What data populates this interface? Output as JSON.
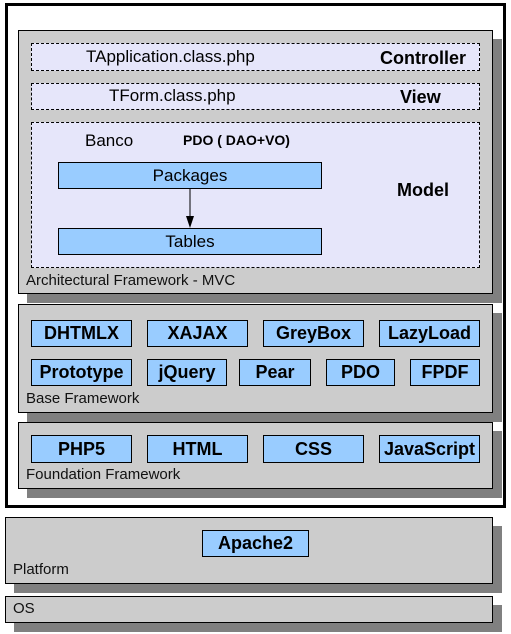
{
  "architectural": {
    "label": "Architectural Framework - MVC",
    "controller": {
      "file": "TApplication.class.php",
      "role": "Controller"
    },
    "view": {
      "file": "TForm.class.php",
      "role": "View"
    },
    "model": {
      "banco": "Banco",
      "pdo": "PDO ( DAO+VO)",
      "packages": "Packages",
      "tables": "Tables",
      "role": "Model"
    }
  },
  "base": {
    "label": "Base Framework",
    "row1": [
      "DHTMLX",
      "XAJAX",
      "GreyBox",
      "LazyLoad"
    ],
    "row2": [
      "Prototype",
      "jQuery",
      "Pear",
      "PDO",
      "FPDF"
    ]
  },
  "foundation": {
    "label": "Foundation Framework",
    "items": [
      "PHP5",
      "HTML",
      "CSS",
      "JavaScript"
    ]
  },
  "platform": {
    "label": "Platform",
    "item": "Apache2"
  },
  "os": {
    "label": "OS"
  },
  "colors": {
    "panel": "#cccccc",
    "shadow": "#808080",
    "box": "#99ccff",
    "dashed": "#e6e6fa"
  }
}
